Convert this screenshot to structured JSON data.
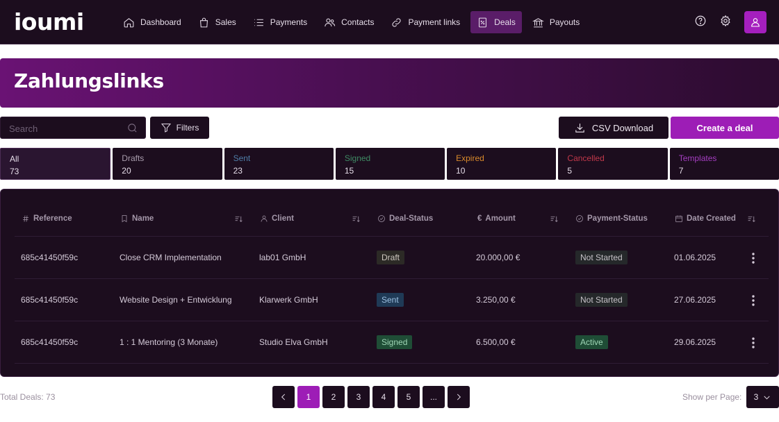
{
  "app": {
    "logo": "ioumi"
  },
  "nav": [
    {
      "label": "Dashboard",
      "icon": "home-icon",
      "active": false
    },
    {
      "label": "Sales",
      "icon": "bag-icon",
      "active": false
    },
    {
      "label": "Payments",
      "icon": "list-icon",
      "active": false
    },
    {
      "label": "Contacts",
      "icon": "users-icon",
      "active": false
    },
    {
      "label": "Payment links",
      "icon": "link-icon",
      "active": false
    },
    {
      "label": "Deals",
      "icon": "deal-icon",
      "active": true
    },
    {
      "label": "Payouts",
      "icon": "bank-icon",
      "active": false
    }
  ],
  "page": {
    "title": "Zahlungslinks"
  },
  "toolbar": {
    "search_placeholder": "Search",
    "filters_label": "Filters",
    "csv_label": "CSV Download",
    "create_label": "Create a deal"
  },
  "status_tabs": [
    {
      "label": "All",
      "count": "73",
      "color": "#e6dde9",
      "active": true
    },
    {
      "label": "Drafts",
      "count": "20",
      "color": "#a99dad",
      "active": false
    },
    {
      "label": "Sent",
      "count": "23",
      "color": "#4f7ea8",
      "active": false
    },
    {
      "label": "Signed",
      "count": "15",
      "color": "#3f8a64",
      "active": false
    },
    {
      "label": "Expired",
      "count": "10",
      "color": "#d98a2b",
      "active": false
    },
    {
      "label": "Cancelled",
      "count": "5",
      "color": "#c0384a",
      "active": false
    },
    {
      "label": "Templates",
      "count": "7",
      "color": "#a43ec0",
      "active": false
    }
  ],
  "table": {
    "headers": {
      "reference": "Reference",
      "name": "Name",
      "client": "Client",
      "deal_status": "Deal-Status",
      "amount": "Amount",
      "payment_status": "Payment-Status",
      "date_created": "Date Created"
    },
    "rows": [
      {
        "reference": "685c41450f59c",
        "name": "Close CRM Implementation",
        "client": "lab01 GmbH",
        "deal_status": "Draft",
        "amount": "20.000,00 €",
        "payment_status": "Not Started",
        "date_created": "01.06.2025"
      },
      {
        "reference": "685c41450f59c",
        "name": "Website Design + Entwicklung",
        "client": "Klarwerk GmbH",
        "deal_status": "Sent",
        "amount": "3.250,00 €",
        "payment_status": "Not Started",
        "date_created": "27.06.2025"
      },
      {
        "reference": "685c41450f59c",
        "name": "1 : 1 Mentoring (3 Monate)",
        "client": "Studio Elva GmbH",
        "deal_status": "Signed",
        "amount": "6.500,00 €",
        "payment_status": "Active",
        "date_created": "29.06.2025"
      }
    ]
  },
  "badge_colors": {
    "Draft": {
      "bg": "#2c2a26",
      "fg": "#cfc9c0"
    },
    "Sent": {
      "bg": "#1f3a56",
      "fg": "#9cc0e2"
    },
    "Signed": {
      "bg": "#1f4d36",
      "fg": "#9fd6b6"
    },
    "Not Started": {
      "bg": "#25282a",
      "fg": "#c6c2c8"
    },
    "Active": {
      "bg": "#1f4d36",
      "fg": "#9fd6b6"
    }
  },
  "footer": {
    "total_label": "Total Deals: 73",
    "pages": [
      "1",
      "2",
      "3",
      "4",
      "5",
      "..."
    ],
    "current_page": "1",
    "per_page_label": "Show per Page:",
    "per_page_value": "3"
  }
}
